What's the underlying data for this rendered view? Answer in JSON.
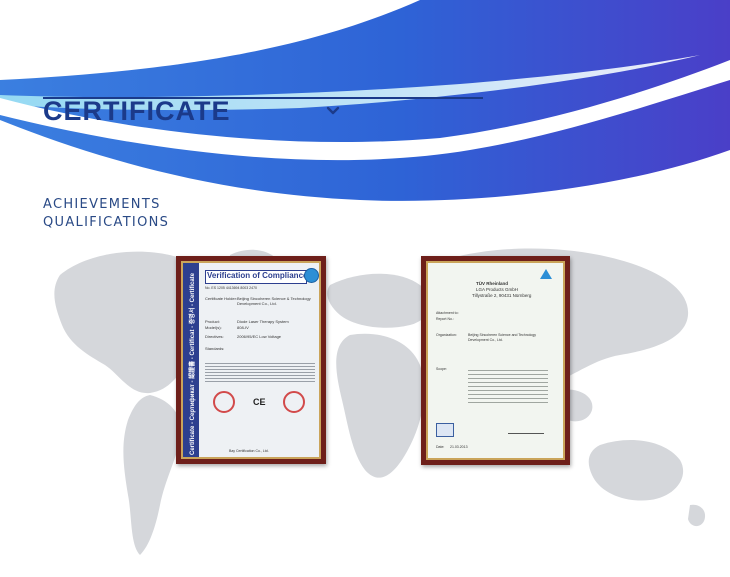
{
  "header": {
    "title": "CERTIFICATE",
    "subtitle_line1": "ACHIEVEMENTS",
    "subtitle_line2": "QUALIFICATIONS",
    "accent_color": "#1b3a8a",
    "chevron_icon": "chevron-down-icon"
  },
  "certificates": [
    {
      "heading": "Verification of Compliance",
      "side_text": "Certificate - Сертификат - 認證書 - Certificat - 증명서 - Certificate",
      "number": "No. ES 1205 4413694 8003 2470",
      "holder_label": "Certificate Holder:",
      "holder": "Beijing Sincoheren Science & Technology Development Co., Ltd.",
      "product_label": "Product:",
      "product": "Diode Laser Therapy System",
      "model_label": "Model(s):",
      "model": "808-IV",
      "directives_label": "Directives:",
      "directives": "2006/95/EC Low Voltage",
      "standards_label": "Standards:",
      "mark": "CE",
      "footer": "Bay Certification Co., Ltd."
    },
    {
      "heading": "TÜV Rheinland",
      "org_line1": "LGA Products GmbH",
      "org_line2": "Tillystraße 2, 90431 Nürnberg",
      "ref_label": "Attachment to:",
      "report_label": "Report No.:",
      "org_label": "Organization:",
      "org": "Beijing Sincoheren Science and Technology Development Co., Ltd.",
      "scope_label": "Scope:",
      "footer_label": "Date:",
      "footer_date": "21.03.2013"
    }
  ]
}
